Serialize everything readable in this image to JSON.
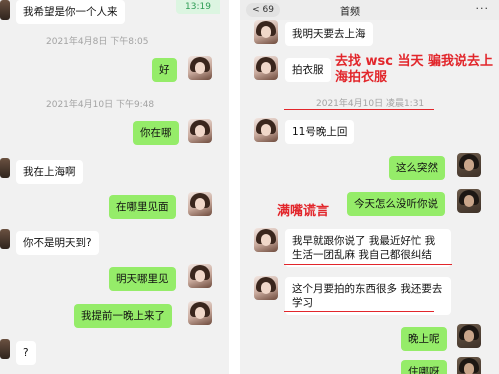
{
  "left_chat": {
    "header_badge": "13:19",
    "messages": [
      {
        "side": "in",
        "text": "我希望是你一个人来"
      },
      {
        "type": "time",
        "text": "2021年4月8日 下午8:05"
      },
      {
        "side": "out",
        "text": "好"
      },
      {
        "type": "time",
        "text": "2021年4月10日 下午9:48"
      },
      {
        "side": "out",
        "text": "你在哪"
      },
      {
        "side": "in",
        "text": "我在上海啊"
      },
      {
        "side": "out",
        "text": "在哪里见面"
      },
      {
        "side": "in",
        "text": "你不是明天到?"
      },
      {
        "side": "out",
        "text": "明天哪里见"
      },
      {
        "side": "out",
        "text": "我提前一晚上来了"
      },
      {
        "side": "in",
        "text": "?"
      }
    ]
  },
  "right_chat": {
    "back_label": "< 69",
    "title": "首频",
    "more_label": "···",
    "messages": [
      {
        "side": "in",
        "text": "我明天要去上海"
      },
      {
        "side": "in",
        "text": "拍衣服"
      },
      {
        "type": "time",
        "text": "2021年4月10日 凌晨1:31"
      },
      {
        "side": "in",
        "text": "11号晚上回"
      },
      {
        "side": "out",
        "text": "这么突然"
      },
      {
        "side": "out",
        "text": "今天怎么没听你说"
      },
      {
        "side": "in",
        "text": "我早就跟你说了 我最近好忙 我生活一团乱麻 我自己都很纠结"
      },
      {
        "side": "in",
        "text": "这个月要拍的东西很多 我还要去学习"
      },
      {
        "side": "out",
        "text": "晚上呢"
      },
      {
        "side": "out",
        "text": "住哪呀"
      }
    ],
    "annotations": {
      "top": "去找 wsc 当天 骗我说去上海拍衣服",
      "middle": "满嘴谎言"
    }
  },
  "colors": {
    "bubble_out": "#95ec69",
    "bubble_in": "#ffffff",
    "annotation": "#e2262b",
    "background": "#f1f1f1"
  }
}
